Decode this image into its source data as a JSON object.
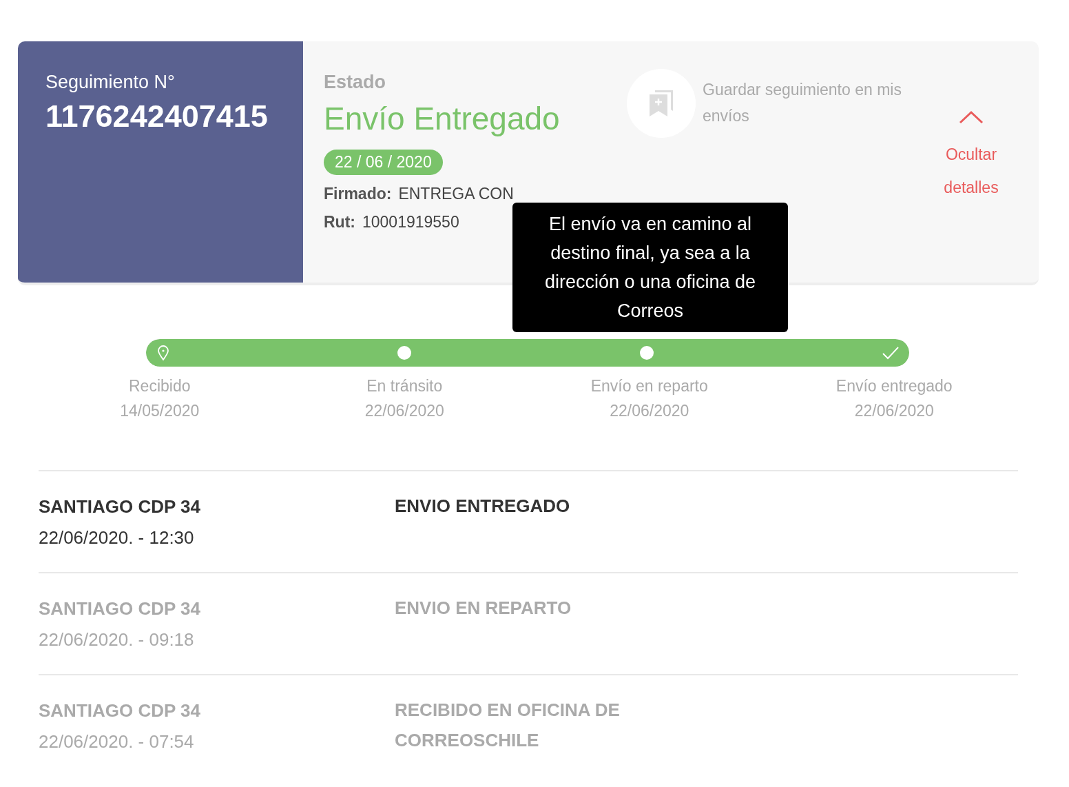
{
  "tracking": {
    "label": "Seguimiento N°",
    "number": "1176242407415"
  },
  "status": {
    "label": "Estado",
    "value": "Envío Entregado",
    "date": "22 / 06 / 2020",
    "fields": [
      {
        "label": "Firmado:",
        "value": "ENTREGA CON"
      },
      {
        "label": "Rut:",
        "value": "10001919550"
      }
    ]
  },
  "save": {
    "label": "Guardar seguimiento en mis envíos"
  },
  "toggle": {
    "label": "Ocultar detalles",
    "expanded": true
  },
  "tooltip": {
    "text": "El envío va en camino al destino final, ya sea a la dirección o una oficina de Correos"
  },
  "progress": {
    "level": 1,
    "steps": [
      {
        "kind": "pin",
        "label": "Recibido",
        "date": "14/05/2020"
      },
      {
        "kind": "dot",
        "label": "En tránsito",
        "date": "22/06/2020"
      },
      {
        "kind": "dot",
        "label": "Envío en reparto",
        "date": "22/06/2020"
      },
      {
        "kind": "check",
        "label": "Envío entregado",
        "date": "22/06/2020"
      }
    ]
  },
  "events": [
    {
      "place": "SANTIAGO CDP 34",
      "time": "22/06/2020. - 12:30",
      "description": "ENVIO ENTREGADO",
      "selected": true
    },
    {
      "place": "SANTIAGO CDP 34",
      "time": "22/06/2020. - 09:18",
      "description": "ENVIO EN REPARTO",
      "selected": false
    },
    {
      "place": "SANTIAGO CDP 34",
      "time": "22/06/2020. - 07:54",
      "description": "RECIBIDO EN OFICINA DE CORREOSCHILE",
      "selected": false
    }
  ]
}
